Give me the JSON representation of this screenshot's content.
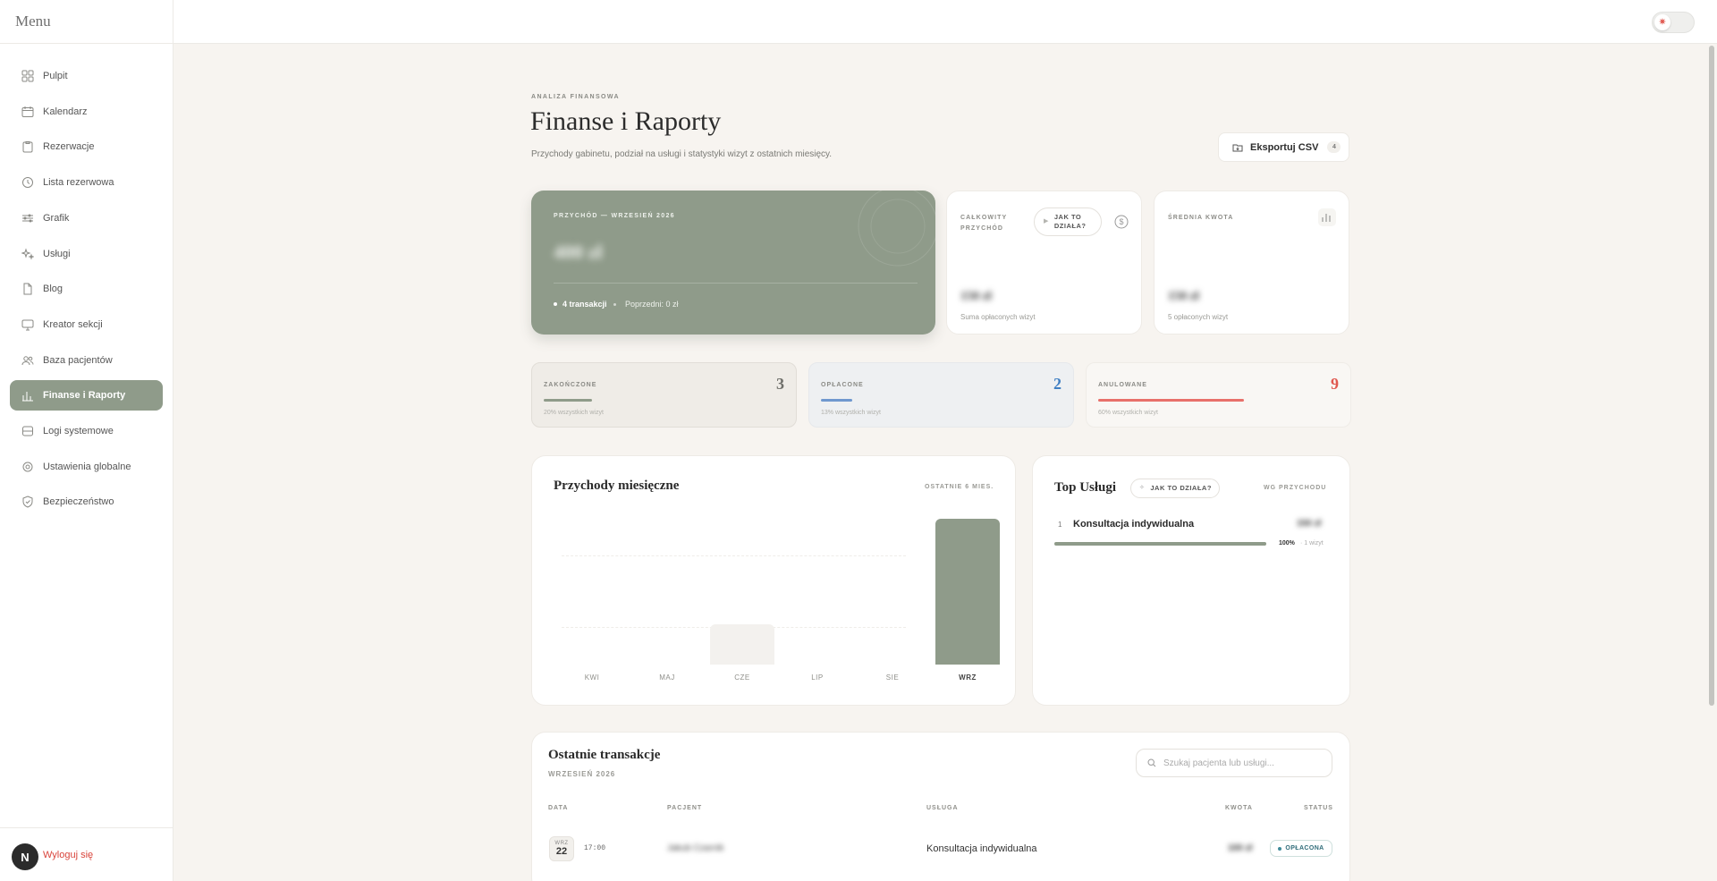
{
  "app": {
    "menu_title": "Menu"
  },
  "sidebar": {
    "items": [
      {
        "label": "Pulpit",
        "icon": "grid-icon"
      },
      {
        "label": "Kalendarz",
        "icon": "calendar-icon"
      },
      {
        "label": "Rezerwacje",
        "icon": "clipboard-icon"
      },
      {
        "label": "Lista rezerwowa",
        "icon": "clock-icon"
      },
      {
        "label": "Grafik",
        "icon": "sliders-icon"
      },
      {
        "label": "Usługi",
        "icon": "sparkles-icon"
      },
      {
        "label": "Blog",
        "icon": "document-icon"
      },
      {
        "label": "Kreator sekcji",
        "icon": "monitor-icon"
      },
      {
        "label": "Baza pacjentów",
        "icon": "users-icon"
      },
      {
        "label": "Finanse i Raporty",
        "icon": "bar-chart-icon",
        "active": true
      },
      {
        "label": "Logi systemowe",
        "icon": "database-icon"
      },
      {
        "label": "Ustawienia globalne",
        "icon": "gear-icon"
      },
      {
        "label": "Bezpieczeństwo",
        "icon": "shield-icon"
      }
    ],
    "logout": {
      "avatar_initial": "N",
      "label": "Wyloguj się"
    }
  },
  "header": {
    "eyebrow": "ANALIZA FINANSOWA",
    "title": "Finanse i Raporty",
    "subtitle": "Przychody gabinetu, podział na usługi i statystyki wizyt z ostatnich miesięcy.",
    "export_label": "Eksportuj CSV",
    "export_count": "4"
  },
  "hero": {
    "label": "PRZYCHÓD — WRZESIEŃ 2026",
    "value": "400 zł",
    "transactions": "4 transakcji",
    "previous": "Poprzedni: 0 zł"
  },
  "total_card": {
    "label_line1": "CAŁKOWITY",
    "label_line2": "PRZYCHÓD",
    "how_line1": "JAK TO",
    "how_line2": "DZIAŁA?",
    "value": "150 zł",
    "sub": "Suma opłaconych wizyt"
  },
  "avg_card": {
    "label": "ŚREDNIA KWOTA",
    "value": "150 zł",
    "sub": "5 opłaconych wizyt"
  },
  "status_cards": [
    {
      "label": "ZAKOŃCZONE",
      "value": "3",
      "sub": "20% wszystkich wizyt",
      "fill": 0.2,
      "color": "#8f9b8a"
    },
    {
      "label": "OPŁACONE",
      "value": "2",
      "sub": "13% wszystkich wizyt",
      "fill": 0.13,
      "color": "#6f98cf"
    },
    {
      "label": "ANULOWANE",
      "value": "9",
      "sub": "60% wszystkich wizyt",
      "fill": 0.6,
      "color": "#e8706a"
    }
  ],
  "monthly": {
    "title": "Przychody miesięczne",
    "tag": "OSTATNIE 6 MIES.",
    "chart_data": {
      "type": "bar",
      "categories": [
        "KWI",
        "MAJ",
        "CZE",
        "LIP",
        "SIE",
        "WRZ"
      ],
      "values": [
        0,
        0,
        110,
        0,
        0,
        400
      ],
      "ylim": [
        0,
        400
      ]
    }
  },
  "top_services": {
    "title": "Top Usługi",
    "how_label": "JAK TO DZIAŁA?",
    "tag": "WG PRZYCHODU",
    "items": [
      {
        "rank": "1",
        "name": "Konsultacja indywidualna",
        "amount": "150 zł",
        "pct": "100%",
        "count": "· 1 wizyt",
        "share": 1.0
      }
    ]
  },
  "transactions": {
    "title": "Ostatnie transakcje",
    "period": "WRZESIEŃ 2026",
    "search_placeholder": "Szukaj pacjenta lub usługi...",
    "columns": {
      "date": "DATA",
      "patient": "PACJENT",
      "service": "USŁUGA",
      "amount": "KWOTA",
      "status": "STATUS"
    },
    "rows": [
      {
        "month": "WRZ",
        "day": "22",
        "time": "17:00",
        "patient": "Jakub Czarnik",
        "service": "Konsultacja indywidualna",
        "amount": "100 zł",
        "status": "OPŁACONA"
      }
    ]
  },
  "colors": {
    "accent": "#8f9b8a",
    "background": "#f7f4f0",
    "danger": "#d9443b",
    "info": "#3f7fc3"
  }
}
